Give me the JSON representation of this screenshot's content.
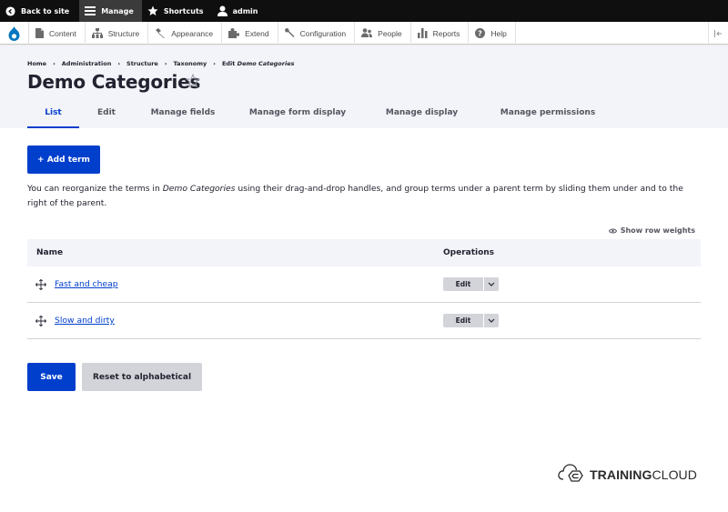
{
  "toolbar": {
    "back_label": "Back to site",
    "manage_label": "Manage",
    "shortcuts_label": "Shortcuts",
    "user_label": "admin"
  },
  "tray": {
    "items": [
      {
        "label": "Content",
        "icon": "content-icon"
      },
      {
        "label": "Structure",
        "icon": "structure-icon"
      },
      {
        "label": "Appearance",
        "icon": "appearance-icon"
      },
      {
        "label": "Extend",
        "icon": "extend-icon"
      },
      {
        "label": "Configuration",
        "icon": "wrench-icon"
      },
      {
        "label": "People",
        "icon": "people-icon"
      },
      {
        "label": "Reports",
        "icon": "reports-icon"
      },
      {
        "label": "Help",
        "icon": "help-icon"
      }
    ]
  },
  "breadcrumb": {
    "items": [
      "Home",
      "Administration",
      "Structure",
      "Taxonomy"
    ],
    "separator": "›",
    "current_prefix": "Edit",
    "current_name": "Demo Categories"
  },
  "page": {
    "title": "Demo Categories"
  },
  "tabs": [
    {
      "label": "List",
      "active": true
    },
    {
      "label": "Edit",
      "active": false
    },
    {
      "label": "Manage fields",
      "active": false
    },
    {
      "label": "Manage form display",
      "active": false
    },
    {
      "label": "Manage display",
      "active": false
    },
    {
      "label": "Manage permissions",
      "active": false
    }
  ],
  "actions": {
    "add_term": "+ Add term"
  },
  "help": {
    "before": "You can reorganize the terms in ",
    "vocab": "Demo Categories",
    "after": " using their drag-and-drop handles, and group terms under a parent term by sliding them under and to the right of the parent."
  },
  "table": {
    "show_row_weights": "Show row weights",
    "headers": {
      "name": "Name",
      "operations": "Operations"
    },
    "rows": [
      {
        "name": "Fast and cheap",
        "operation": "Edit"
      },
      {
        "name": "Slow and dirty",
        "operation": "Edit"
      }
    ]
  },
  "form": {
    "save": "Save",
    "reset": "Reset to alphabetical"
  },
  "watermark": {
    "bold": "TRAINING",
    "regular": "CLOUD"
  },
  "colors": {
    "primary": "#003ecc",
    "toolbar_bg": "#0f0f0f",
    "header_bg": "#f3f4f9",
    "secondary_button": "#d3d4d9"
  }
}
